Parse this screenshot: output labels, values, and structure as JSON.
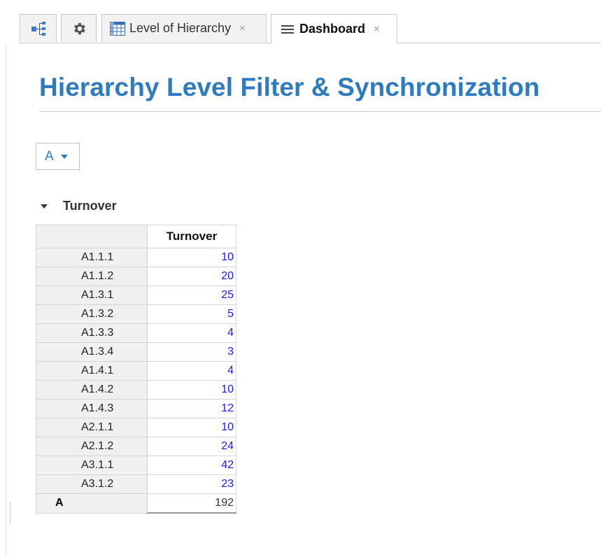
{
  "tabs": [
    {
      "id": "tree",
      "icon": "tree-icon"
    },
    {
      "id": "settings",
      "icon": "gear-icon"
    },
    {
      "id": "level",
      "icon": "table-icon",
      "label": "Level of Hierarchy",
      "close": "×"
    },
    {
      "id": "dashboard",
      "icon": "menu-icon",
      "label": "Dashboard",
      "close": "×"
    }
  ],
  "page": {
    "title": "Hierarchy Level Filter & Synchronization"
  },
  "filter": {
    "selected": "A"
  },
  "section": {
    "label": "Turnover"
  },
  "table": {
    "column_header": "Turnover",
    "rows": [
      {
        "label": "A1.1.1",
        "value": "10"
      },
      {
        "label": "A1.1.2",
        "value": "20"
      },
      {
        "label": "A1.3.1",
        "value": "25"
      },
      {
        "label": "A1.3.2",
        "value": "5"
      },
      {
        "label": "A1.3.3",
        "value": "4"
      },
      {
        "label": "A1.3.4",
        "value": "3"
      },
      {
        "label": "A1.4.1",
        "value": "4"
      },
      {
        "label": "A1.4.2",
        "value": "10"
      },
      {
        "label": "A1.4.3",
        "value": "12"
      },
      {
        "label": "A2.1.1",
        "value": "10"
      },
      {
        "label": "A2.1.2",
        "value": "24"
      },
      {
        "label": "A3.1.1",
        "value": "42"
      },
      {
        "label": "A3.1.2",
        "value": "23"
      }
    ],
    "total": {
      "label": "A",
      "value": "192"
    }
  },
  "colors": {
    "accent": "#2f7bbf",
    "value_link": "#1a1aff"
  }
}
